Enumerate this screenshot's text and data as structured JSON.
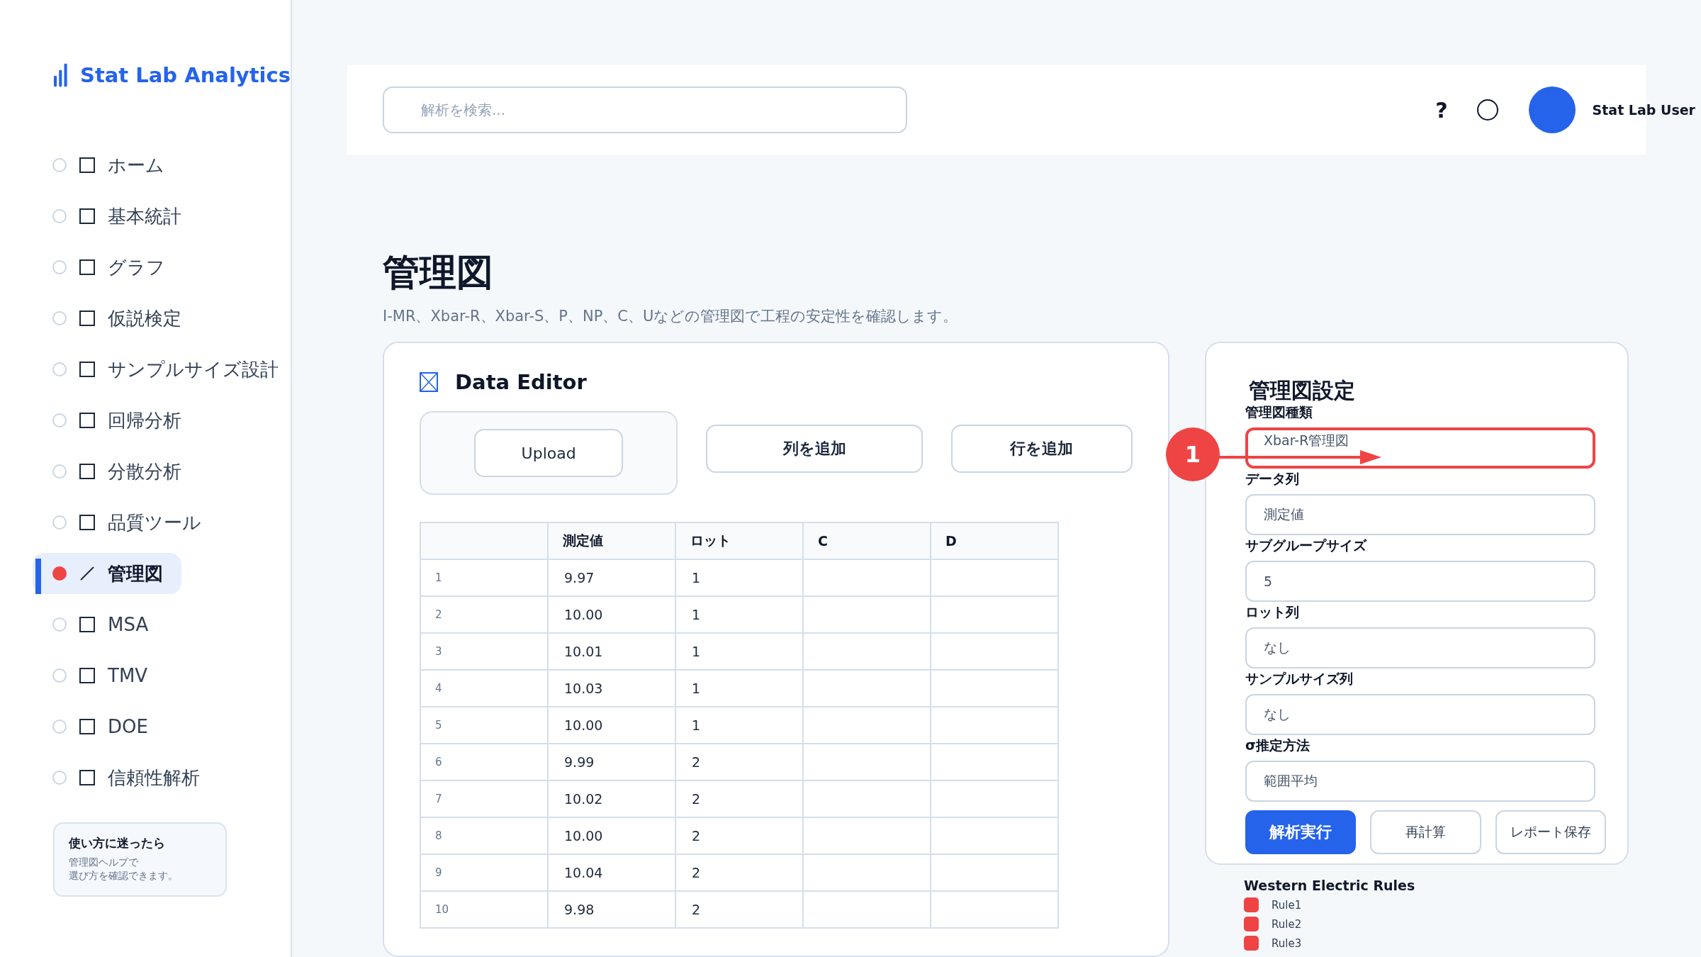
{
  "brand": {
    "name": "Stat Lab Analytics"
  },
  "sidebar": {
    "items": [
      {
        "label": "ホーム",
        "selected": false
      },
      {
        "label": "基本統計",
        "selected": false
      },
      {
        "label": "グラフ",
        "selected": false
      },
      {
        "label": "仮説検定",
        "selected": false
      },
      {
        "label": "サンプルサイズ設計",
        "selected": false
      },
      {
        "label": "回帰分析",
        "selected": false
      },
      {
        "label": "分散分析",
        "selected": false
      },
      {
        "label": "品質ツール",
        "selected": false
      },
      {
        "label": "管理図",
        "selected": true
      },
      {
        "label": "MSA",
        "selected": false
      },
      {
        "label": "TMV",
        "selected": false
      },
      {
        "label": "DOE",
        "selected": false
      },
      {
        "label": "信頼性解析",
        "selected": false
      }
    ]
  },
  "help_card": {
    "title": "使い方に迷ったら",
    "lines": [
      "管理図ヘルプで",
      "選び方を確認できます。"
    ]
  },
  "topbar": {
    "search": {
      "placeholder": "解析を検索..."
    },
    "help": "?",
    "user": {
      "name": "Stat Lab User"
    }
  },
  "page": {
    "title": "管理図",
    "subtitle": "I-MR、Xbar-R、Xbar-S、P、NP、C、Uなどの管理図で工程の安定性を確認します。"
  },
  "data_editor": {
    "title": "Data Editor",
    "upload_button": "Upload",
    "buttons": [
      "列を追加",
      "行を追加"
    ],
    "table": {
      "columns": [
        "測定値",
        "ロット",
        "C",
        "D"
      ],
      "rows": [
        {
          "index": "1",
          "cells": [
            "9.97",
            "1"
          ]
        },
        {
          "index": "2",
          "cells": [
            "10.00",
            "1"
          ]
        },
        {
          "index": "3",
          "cells": [
            "10.01",
            "1"
          ]
        },
        {
          "index": "4",
          "cells": [
            "10.03",
            "1"
          ]
        },
        {
          "index": "5",
          "cells": [
            "10.00",
            "1"
          ]
        },
        {
          "index": "6",
          "cells": [
            "9.99",
            "2"
          ]
        },
        {
          "index": "7",
          "cells": [
            "10.02",
            "2"
          ]
        },
        {
          "index": "8",
          "cells": [
            "10.00",
            "2"
          ]
        },
        {
          "index": "9",
          "cells": [
            "10.04",
            "2"
          ]
        },
        {
          "index": "10",
          "cells": [
            "9.98",
            "2"
          ]
        }
      ]
    }
  },
  "settings": {
    "title": "管理図設定",
    "fields": [
      {
        "label": "管理図種類",
        "value": "Xbar-R管理図",
        "highlighted": true
      },
      {
        "label": "データ列",
        "value": "測定値",
        "highlighted": false
      },
      {
        "label": "サブグループサイズ",
        "value": "5",
        "highlighted": false
      },
      {
        "label": "ロット列",
        "value": "なし",
        "highlighted": false
      },
      {
        "label": "サンプルサイズ列",
        "value": "なし",
        "highlighted": false
      },
      {
        "label": "σ推定方法",
        "value": "範囲平均",
        "highlighted": false
      }
    ],
    "buttons": [
      {
        "label": "解析実行",
        "primary": true
      },
      {
        "label": "再計算",
        "primary": false
      },
      {
        "label": "レポート保存",
        "primary": false
      }
    ],
    "rules": {
      "title": "Western Electric Rules",
      "items": [
        {
          "label": "Rule1",
          "checked": true
        },
        {
          "label": "Rule2",
          "checked": true
        },
        {
          "label": "Rule3",
          "checked": true
        }
      ]
    }
  },
  "annotation": {
    "number": "1"
  }
}
